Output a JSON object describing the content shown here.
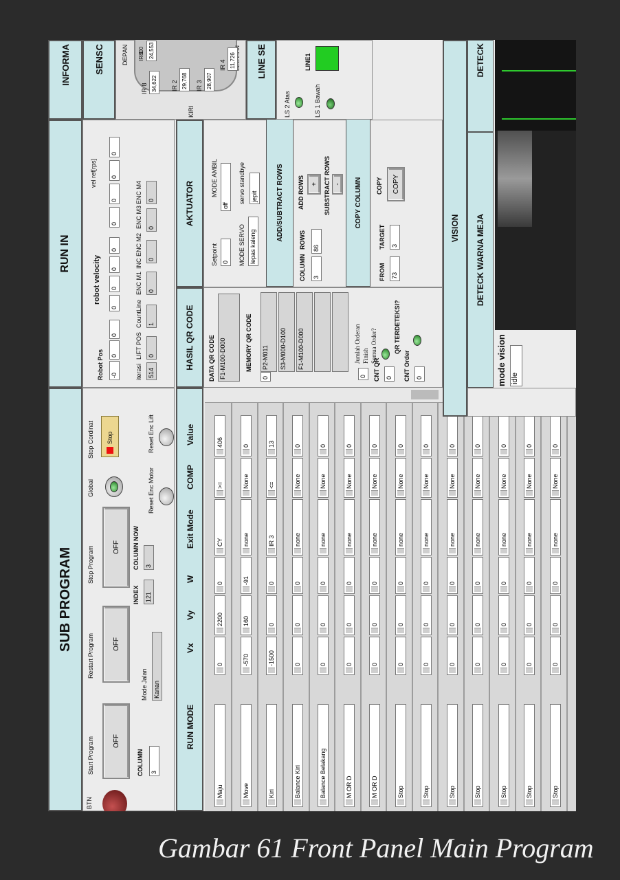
{
  "sections": {
    "sub_program": "SUB PROGRAM",
    "run_in": "RUN IN",
    "informasi": "INFORMA",
    "sensor": "SENSC",
    "hasil_qr": "HASIL QR CODE",
    "aktuator": "AKTUATOR",
    "line_sensor": "LINE SE",
    "vision": "VISION",
    "deteck_warna": "DETECK WARNA MEJA",
    "deteck": "DETECK",
    "run_mode": "RUN MODE"
  },
  "sub": {
    "btn_label": "BTN",
    "start_program": "Start Program",
    "restart_program": "Restart Program",
    "stop_program": "Stop Program",
    "global": "Global",
    "stop_cordinat": "Stop Cordinat",
    "start_state": "OFF",
    "restart_state": "OFF",
    "stop_state": "OFF",
    "stop_button": "Stop",
    "column_label": "COLUMN",
    "column_value": "3",
    "mode_jalan_label": "Mode Jalan",
    "mode_jalan_value": "Kanan",
    "index_label": "INDEX",
    "index_value": "121",
    "column_now_label": "COLUMN NOW",
    "column_now_value": "3",
    "reset_enc_motor": "Reset Enc Motor",
    "reset_enc_lift": "Reset Enc Lift"
  },
  "runin": {
    "robot_pos_label": "Robot Pos",
    "robot_pos": [
      "-0",
      "0",
      "0"
    ],
    "robot_velocity_label": "robot velocity",
    "robot_velocity": [
      "0",
      "0",
      "0",
      "0"
    ],
    "vel_ref_label": "vel ref[rps]",
    "vel_ref": [
      "0",
      "0",
      "0",
      "0"
    ],
    "enc_headers": [
      "iterasi",
      "LIFT POS",
      "CountLine",
      "ENC M1",
      "INC ENC M2",
      "ENC M3",
      "ENC M4"
    ],
    "enc_values": [
      "514",
      "0",
      "1",
      "0",
      "0",
      "0",
      "0"
    ]
  },
  "sensor": {
    "depan": "DEPAN",
    "belakang": "BELAKAN",
    "kiri": "KIRI",
    "ir": [
      {
        "label": "IR 8",
        "value": "34,622"
      },
      {
        "label": "IR 1",
        "value": "800"
      },
      {
        "label": "",
        "value": "24,553"
      },
      {
        "label": "IR 2",
        "value": "29,768"
      },
      {
        "label": "IR 3",
        "value": "28,907"
      },
      {
        "label": "IR 4",
        "value": "11,726"
      }
    ]
  },
  "qr": {
    "data_label": "DATA QR CODE",
    "data_value": "F1-M100-D000",
    "memory_label": "MEMORY QR CODE",
    "memory_index": "0",
    "memory": [
      "P2-M011",
      "S3-M000-D100",
      "F1-M100-D000",
      "",
      ""
    ],
    "jumlah": "Jumlah Orderan",
    "finish": "Finish",
    "semua": "Semua Order?",
    "cnt_qr_label": "CNT QR",
    "cnt_qr": "0",
    "qr_terdeteksi": "QR TERDETEKSI?",
    "cnt_order_label": "CNT Order",
    "cnt_order": "0",
    "jumlah_value": "0"
  },
  "akt": {
    "setpoint_label": "Setpoint",
    "setpoint": "0",
    "mode_ambil_label": "MODE AMBIL",
    "mode_ambil": "off",
    "mode_servo_label": "MODE SERVO",
    "mode_servo": "lepas kaleng",
    "servo_standbye": "servo standbye",
    "servo_value": "jepit",
    "add_subtract": "ADD/SUBTRACT ROWS",
    "column_label": "COLUMN",
    "rows_label": "ROWS",
    "column": "3",
    "rows": "86",
    "add_rows": "ADD ROWS",
    "subtract_rows": "SUBSTRACT ROWS",
    "plus": "+",
    "minus": "-",
    "copy_column": "COPY COLUMN",
    "from_label": "FROM",
    "target_label": "TARGET",
    "from": "73",
    "target": "3",
    "copy": "COPY",
    "copy_button": "COPY"
  },
  "line": {
    "ls2": "LS 2 Atas",
    "ls1": "LS 1 Bawah",
    "line1": "LINE1",
    "led_color": "#22cc22"
  },
  "vision": {
    "mode_label": "mode vision",
    "mode_value": "idle"
  },
  "table": {
    "headers": [
      "RUN MODE",
      "Vx",
      "Vy",
      "W",
      "Exit Mode",
      "COMP",
      "Value"
    ],
    "rows": [
      [
        "Maju",
        "0",
        "2200",
        "0",
        "CY",
        ">=",
        "406"
      ],
      [
        "Move",
        "-570",
        "160",
        "-91",
        "none",
        "None",
        "0"
      ],
      [
        "Kiri",
        "-1500",
        "0",
        "0",
        "IR 3",
        "<=",
        "13"
      ],
      [
        "Balance Kiri",
        "0",
        "0",
        "0",
        "none",
        "None",
        "0"
      ],
      [
        "Balance Belakang",
        "0",
        "0",
        "0",
        "none",
        "None",
        "0"
      ],
      [
        "M OR D",
        "0",
        "0",
        "0",
        "none",
        "None",
        "0"
      ],
      [
        "M OR D",
        "0",
        "0",
        "0",
        "none",
        "None",
        "0"
      ],
      [
        "Stop",
        "0",
        "0",
        "0",
        "none",
        "None",
        "0"
      ],
      [
        "Stop",
        "0",
        "0",
        "0",
        "none",
        "None",
        "0"
      ],
      [
        "Stop",
        "0",
        "0",
        "0",
        "none",
        "None",
        "0"
      ],
      [
        "Stop",
        "0",
        "0",
        "0",
        "none",
        "None",
        "0"
      ],
      [
        "Stop",
        "0",
        "0",
        "0",
        "none",
        "None",
        "0"
      ],
      [
        "Stop",
        "0",
        "0",
        "0",
        "none",
        "None",
        "0"
      ],
      [
        "Stop",
        "0",
        "0",
        "0",
        "none",
        "None",
        "0"
      ]
    ]
  },
  "caption": "Gambar 61 Front Panel Main Program"
}
